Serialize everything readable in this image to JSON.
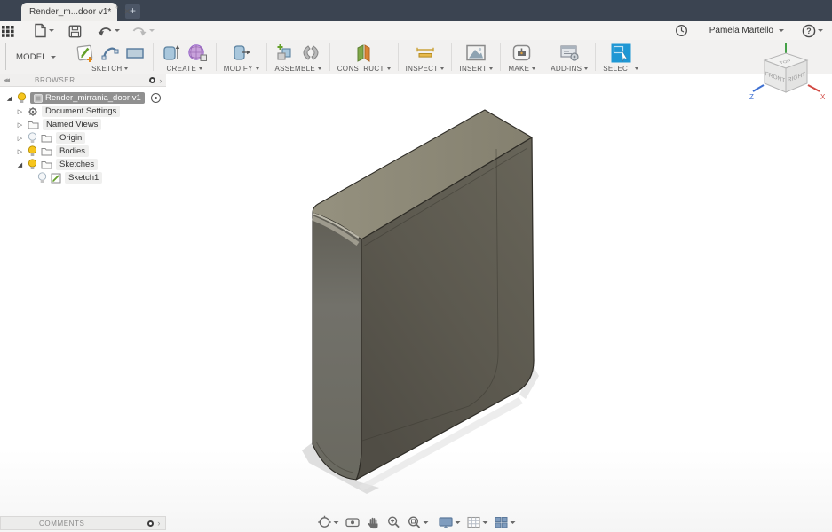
{
  "titlebar": {
    "tab_title": "Render_m...door v1*",
    "modified_indicator": "°",
    "close_glyph": "✕",
    "new_tab_label": "+"
  },
  "quickbar": {
    "icons": [
      "apps-grid-icon",
      "file-menu-icon",
      "save-icon",
      "undo-icon",
      "redo-icon"
    ],
    "redo_disabled": true
  },
  "account": {
    "user_name": "Pamela Martello",
    "icons": [
      "clock-icon",
      "help-icon"
    ]
  },
  "ribbon": {
    "model_label": "MODEL",
    "groups": [
      {
        "label": "SKETCH",
        "icons": [
          "create-sketch-icon",
          "spline-icon",
          "rectangle-icon"
        ]
      },
      {
        "label": "CREATE",
        "icons": [
          "extrude-box-icon",
          "form-sphere-icon"
        ]
      },
      {
        "label": "MODIFY",
        "icons": [
          "press-pull-icon"
        ]
      },
      {
        "label": "ASSEMBLE",
        "icons": [
          "new-component-icon",
          "joint-icon"
        ]
      },
      {
        "label": "CONSTRUCT",
        "icons": [
          "construction-plane-icon"
        ]
      },
      {
        "label": "INSPECT",
        "icons": [
          "measure-icon"
        ]
      },
      {
        "label": "INSERT",
        "icons": [
          "insert-image-icon"
        ]
      },
      {
        "label": "MAKE",
        "icons": [
          "3d-print-icon"
        ]
      },
      {
        "label": "ADD-INS",
        "icons": [
          "scripts-addins-icon"
        ]
      },
      {
        "label": "SELECT",
        "icons": [
          "select-cursor-icon"
        ],
        "highlighted": true
      }
    ]
  },
  "browser": {
    "header": "BROWSER",
    "root": {
      "label": "Render_mirrania_door v1",
      "selected": true,
      "bulb": "on"
    },
    "items": [
      {
        "label": "Document Settings",
        "icon": "gear-icon",
        "expander": "collapsed"
      },
      {
        "label": "Named Views",
        "icon": "folder-icon",
        "expander": "collapsed"
      },
      {
        "label": "Origin",
        "icon": "folder-icon",
        "bulb": "off",
        "expander": "collapsed"
      },
      {
        "label": "Bodies",
        "icon": "folder-icon",
        "bulb": "on",
        "expander": "collapsed"
      },
      {
        "label": "Sketches",
        "icon": "folder-icon",
        "bulb": "on",
        "expander": "expanded"
      },
      {
        "label": "Sketch1",
        "icon": "sketch-icon",
        "bulb": "off"
      }
    ]
  },
  "viewcube": {
    "faces": {
      "top": "TOP",
      "front": "FRONT",
      "right": "RIGHT"
    },
    "axes": {
      "x": "X",
      "z": "Z"
    },
    "axis_colors": {
      "x": "#d24a43",
      "y": "#43a047",
      "z": "#3d6fd2"
    }
  },
  "comments": {
    "header": "COMMENTS"
  },
  "navbar": {
    "items": [
      {
        "name": "orbit-icon",
        "caret": true
      },
      {
        "name": "look-at-icon",
        "caret": false
      },
      {
        "name": "pan-icon",
        "caret": false
      },
      {
        "name": "zoom-icon",
        "caret": false
      },
      {
        "name": "fit-icon",
        "caret": true
      },
      {
        "name": "display-settings-icon",
        "caret": true
      },
      {
        "name": "layout-grid-icon",
        "caret": true
      },
      {
        "name": "viewports-icon",
        "caret": true
      }
    ]
  },
  "colors": {
    "titlebar_bg": "#3b4451",
    "ribbon_bg": "#f2f1f0",
    "select_accent": "#1f97d4",
    "bulb_yellow": "#f6c51d",
    "selection_gray": "#909090",
    "model_face_top": "#89857a",
    "model_face_left": "#6e6d66",
    "model_face_main": "#5c594f"
  }
}
